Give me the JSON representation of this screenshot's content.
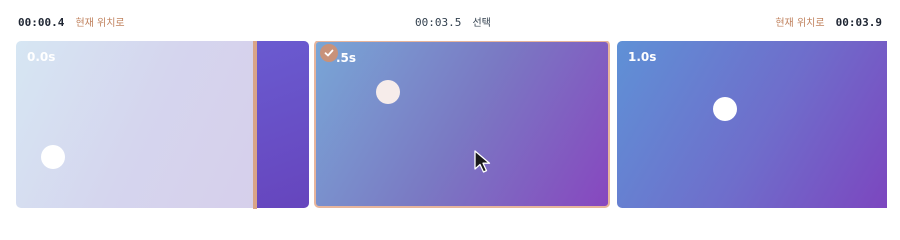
{
  "left_readout": {
    "time": "00:00.4",
    "hint": "현재 위치로"
  },
  "center_readout": {
    "time": "00:03.5",
    "label": "선택"
  },
  "right_readout": {
    "time": "00:03.9",
    "hint": "현재 위치로"
  },
  "frames": [
    {
      "label": "0.0s"
    },
    {
      "label": ".5s",
      "selected": true
    },
    {
      "label": "1.0s"
    }
  ],
  "colors": {
    "accent": "#d9a487",
    "text_dark": "#1f2633",
    "hint": "#c0825e"
  },
  "icons": {
    "selected_badge": "check-icon",
    "pointer": "arrow-cursor-icon"
  }
}
